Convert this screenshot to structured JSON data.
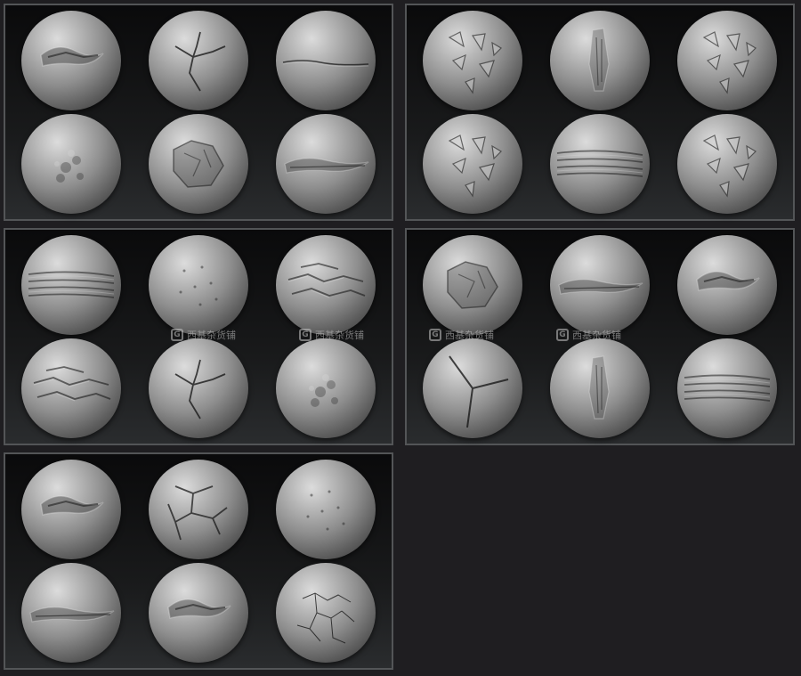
{
  "panels": [
    {
      "id": "p0",
      "brushes": [
        "crust",
        "crack-branch",
        "crack-line",
        "bumpy",
        "rocky",
        "band"
      ]
    },
    {
      "id": "p1",
      "brushes": [
        "shards",
        "spike",
        "shards",
        "shards",
        "layers",
        "shards"
      ]
    },
    {
      "id": "p2",
      "brushes": [
        "layers",
        "noise",
        "flaky",
        "flaky",
        "crack-branch",
        "bumpy"
      ]
    },
    {
      "id": "p3",
      "brushes": [
        "rocky",
        "band",
        "crust",
        "crack-y",
        "spike",
        "layers"
      ]
    },
    {
      "id": "p4",
      "brushes": [
        "crust",
        "cracked-plates",
        "noise",
        "band",
        "crust",
        "fine-cracks"
      ]
    }
  ],
  "watermark": {
    "icon": "G",
    "text": "西基杂货铺"
  }
}
